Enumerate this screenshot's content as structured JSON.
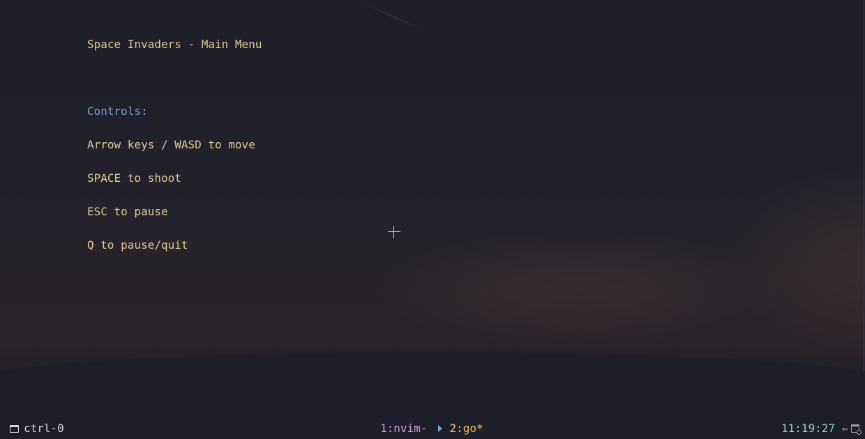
{
  "terminal": {
    "title": "Space Invaders - Main Menu",
    "controls_heading": "Controls:",
    "controls": [
      "Arrow keys / WASD to move",
      "SPACE to shoot",
      "ESC to pause",
      "Q to pause/quit"
    ]
  },
  "statusbar": {
    "session": "ctrl-0",
    "windows": [
      {
        "label": "1:nvim-",
        "active": false
      },
      {
        "label": "2:go*",
        "active": true
      }
    ],
    "clock": "11:19:27"
  },
  "colors": {
    "text": "#e2cc94",
    "heading": "#7f9fd6",
    "window_inactive": "#c4a4dc",
    "window_active": "#f0bf6a",
    "clock": "#8fd0c8"
  },
  "icons": {
    "session": "session-icon",
    "separator": "triangle-right-icon",
    "back": "arrow-left-icon",
    "calendar": "calendar-clock-icon",
    "cursor": "crosshair-cursor-icon"
  }
}
